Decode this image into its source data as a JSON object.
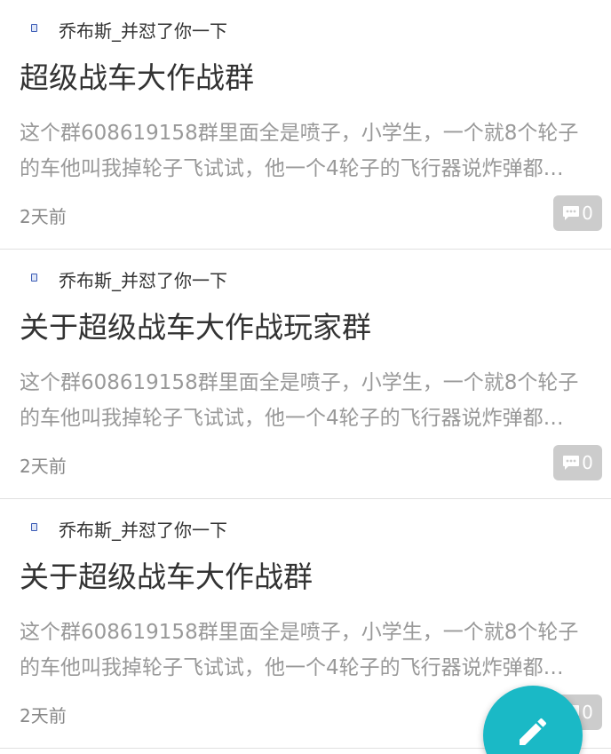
{
  "posts": [
    {
      "author": "乔布斯_并怼了你一下",
      "title": "超级战车大作战群",
      "excerpt_line1": "这个群608619158群里面全是喷子，小学生，一个就8个轮子",
      "excerpt_line2": "的车他叫我掉轮子飞试试，他一个4轮子的飞行器说炸弹都…",
      "time": "2天前",
      "comments": "0"
    },
    {
      "author": "乔布斯_并怼了你一下",
      "title": "关于超级战车大作战玩家群",
      "excerpt_line1": "这个群608619158群里面全是喷子，小学生，一个就8个轮子",
      "excerpt_line2": "的车他叫我掉轮子飞试试，他一个4轮子的飞行器说炸弹都…",
      "time": "2天前",
      "comments": "0"
    },
    {
      "author": "乔布斯_并怼了你一下",
      "title": "关于超级战车大作战群",
      "excerpt_line1": "这个群608619158群里面全是喷子，小学生，一个就8个轮子",
      "excerpt_line2": "的车他叫我掉轮子飞试试，他一个4轮子的飞行器说炸弹都…",
      "time": "2天前",
      "comments": "0"
    }
  ],
  "colors": {
    "fab": "#1ab9c6",
    "badge": "#cccccc"
  },
  "icons": {
    "avatar": "avatar-image",
    "comment": "chat-bubble-icon",
    "fab": "pencil-icon"
  }
}
